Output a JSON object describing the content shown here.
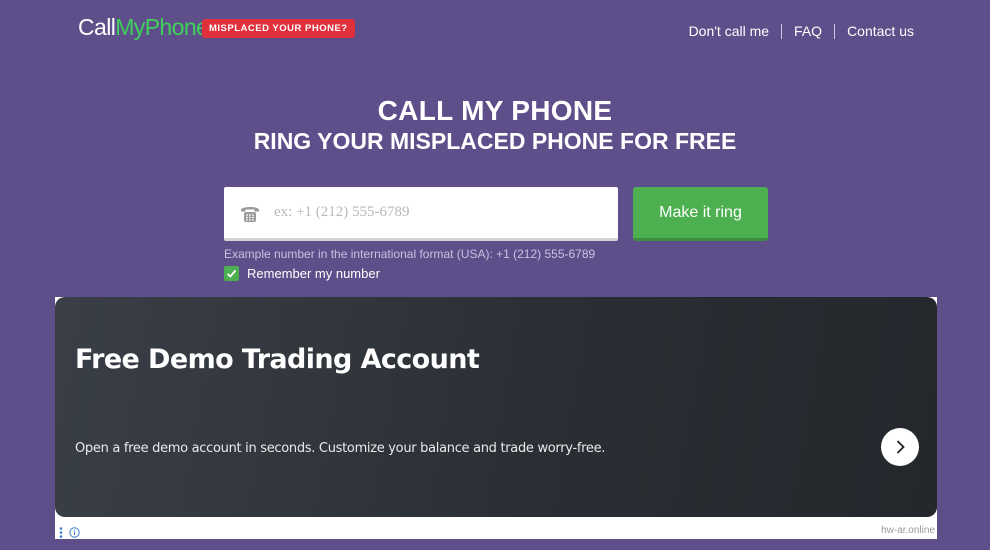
{
  "header": {
    "logo": {
      "part1": "Call",
      "part2": "MyPhone"
    },
    "badge": "MISPLACED YOUR PHONE?",
    "nav": [
      "Don't call me",
      "FAQ",
      "Contact us"
    ]
  },
  "hero": {
    "title": "CALL MY PHONE",
    "subtitle": "RING YOUR MISPLACED PHONE FOR FREE"
  },
  "form": {
    "phone_placeholder": "ex: +1 (212) 555-6789",
    "phone_value": "",
    "submit_label": "Make it ring",
    "hint": "Example number in the international format (USA): +1 (212) 555-6789",
    "remember_label": "Remember my number",
    "remember_checked": true,
    "icon": "telephone-icon"
  },
  "ad": {
    "title": "Free Demo Trading Account",
    "text": "Open a free demo account in seconds. Customize your balance and trade worry-free.",
    "domain": "hw-ar.online",
    "icons": [
      "more-vertical-icon",
      "info-icon",
      "chevron-right-icon"
    ]
  },
  "colors": {
    "background": "#5e4f8a",
    "accent_green": "#4caf50",
    "logo_green": "#3fd15c",
    "badge_red": "#e0303c"
  }
}
